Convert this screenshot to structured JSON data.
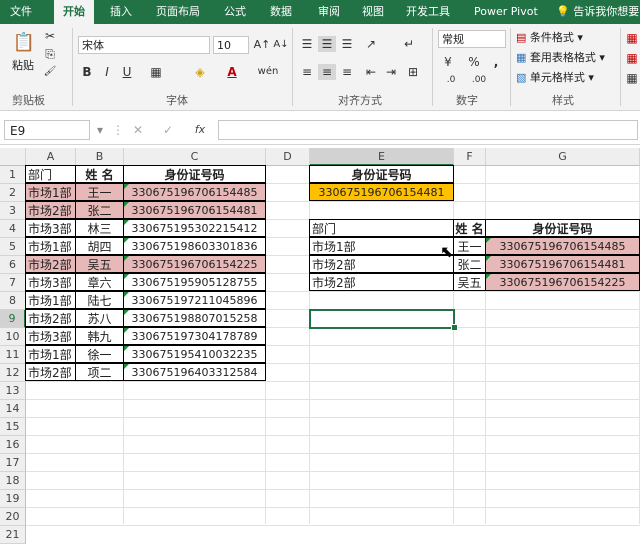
{
  "ribbon_tabs": [
    "文件",
    "开始",
    "插入",
    "页面布局",
    "公式",
    "数据",
    "审阅",
    "视图",
    "开发工具",
    "Power Pivot"
  ],
  "tell_me": "告诉我你想要",
  "clipboard": {
    "cut": "✂",
    "copy": "⎘",
    "paste": "粘贴",
    "painter": "🖌",
    "label": "剪贴板"
  },
  "font": {
    "name": "宋体",
    "size": "10",
    "grow": "A↑",
    "shrink": "A↓",
    "bold": "B",
    "italic": "I",
    "underline": "U",
    "border": "▦",
    "fill": "◈",
    "color": "A",
    "wen": "wén",
    "label": "字体"
  },
  "alignment": {
    "label": "对齐方式"
  },
  "number": {
    "format": "常规",
    "currency": "¥",
    "percent": "%",
    "comma": ",",
    "inc": ".0",
    "dec": ".00",
    "label": "数字"
  },
  "styles": {
    "conditional": "条件格式",
    "table": "套用表格格式",
    "cell": "单元格样式",
    "label": "样式"
  },
  "name_box": "E9",
  "fx": "fx",
  "col_headers": [
    "A",
    "B",
    "C",
    "D",
    "E",
    "F",
    "G"
  ],
  "row_headers": [
    "1",
    "2",
    "3",
    "4",
    "5",
    "6",
    "7",
    "8",
    "9",
    "10",
    "11",
    "12",
    "13",
    "14",
    "15",
    "16",
    "17",
    "18",
    "19",
    "20",
    "21"
  ],
  "table1": {
    "headers": [
      "部门",
      "姓 名",
      "身份证号码"
    ],
    "rows": [
      [
        "市场1部",
        "王一",
        "330675196706154485"
      ],
      [
        "市场2部",
        "张二",
        "330675196706154481"
      ],
      [
        "市场3部",
        "林三",
        "330675195302215412"
      ],
      [
        "市场1部",
        "胡四",
        "330675198603301836"
      ],
      [
        "市场2部",
        "吴五",
        "330675196706154225"
      ],
      [
        "市场3部",
        "章六",
        "330675195905128755"
      ],
      [
        "市场1部",
        "陆七",
        "330675197211045896"
      ],
      [
        "市场2部",
        "苏八",
        "330675198807015258"
      ],
      [
        "市场3部",
        "韩九",
        "330675197304178789"
      ],
      [
        "市场1部",
        "徐一",
        "330675195410032235"
      ],
      [
        "市场2部",
        "项二",
        "330675196403312584"
      ]
    ]
  },
  "lookup": {
    "header": "身份证号码",
    "value": "330675196706154481"
  },
  "table2": {
    "headers": [
      "部门",
      "姓 名",
      "身份证号码"
    ],
    "rows": [
      [
        "市场1部",
        "王一",
        "330675196706154485"
      ],
      [
        "市场2部",
        "张二",
        "330675196706154481"
      ],
      [
        "市场2部",
        "吴五",
        "330675196706154225"
      ]
    ]
  }
}
